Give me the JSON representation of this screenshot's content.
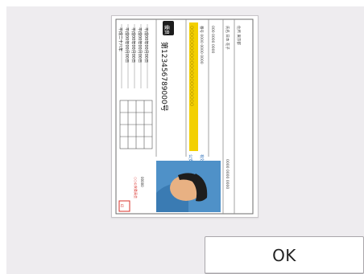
{
  "dialog": {
    "ok_label": "OK"
  },
  "preview": {
    "document_icon": "rotated-id-card-icon",
    "card_number": "第123456789000号",
    "badge": "優良",
    "colors": {
      "highlight": "#f3d000",
      "photo_bg": "#4f91c8",
      "face": "#e8b183",
      "hair": "#1d1d1d",
      "stamp": "#d8302a",
      "accent_text": "#2c6fb9"
    }
  }
}
